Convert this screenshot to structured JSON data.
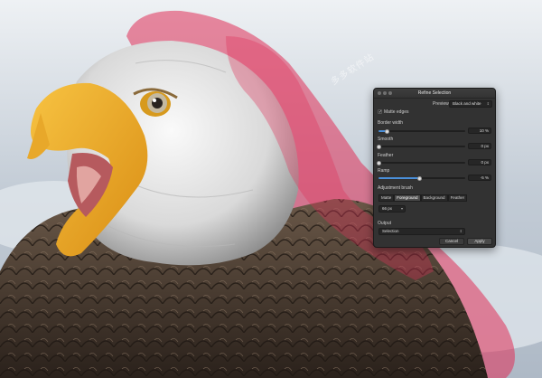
{
  "dialog": {
    "title": "Refine Selection",
    "preview_label": "Preview",
    "preview_mode": "Black and white",
    "matte_edges_label": "Matte edges",
    "matte_edges_checked": true,
    "border_width": {
      "label": "Border width",
      "value": "10 %",
      "fraction": 0.1
    },
    "smooth": {
      "label": "Smooth",
      "value": "0 px",
      "fraction": 0.0
    },
    "feather": {
      "label": "Feather",
      "value": "0 px",
      "fraction": 0.0
    },
    "ramp": {
      "label": "Ramp",
      "value": "-5 %",
      "fraction": 0.47
    },
    "adjustment_brush_label": "Adjustment brush",
    "brush_modes": [
      "Matte",
      "Foreground",
      "Background",
      "Feather"
    ],
    "brush_mode_selected": "Foreground",
    "brush_size": "66 px",
    "output_label": "Output",
    "output_value": "Selection",
    "cancel_label": "Cancel",
    "apply_label": "Apply"
  },
  "watermark": "多多软件站",
  "colors": {
    "overlay": "#e03058",
    "slider_fill": "#4a8fd9",
    "panel_bg": "#323232"
  }
}
